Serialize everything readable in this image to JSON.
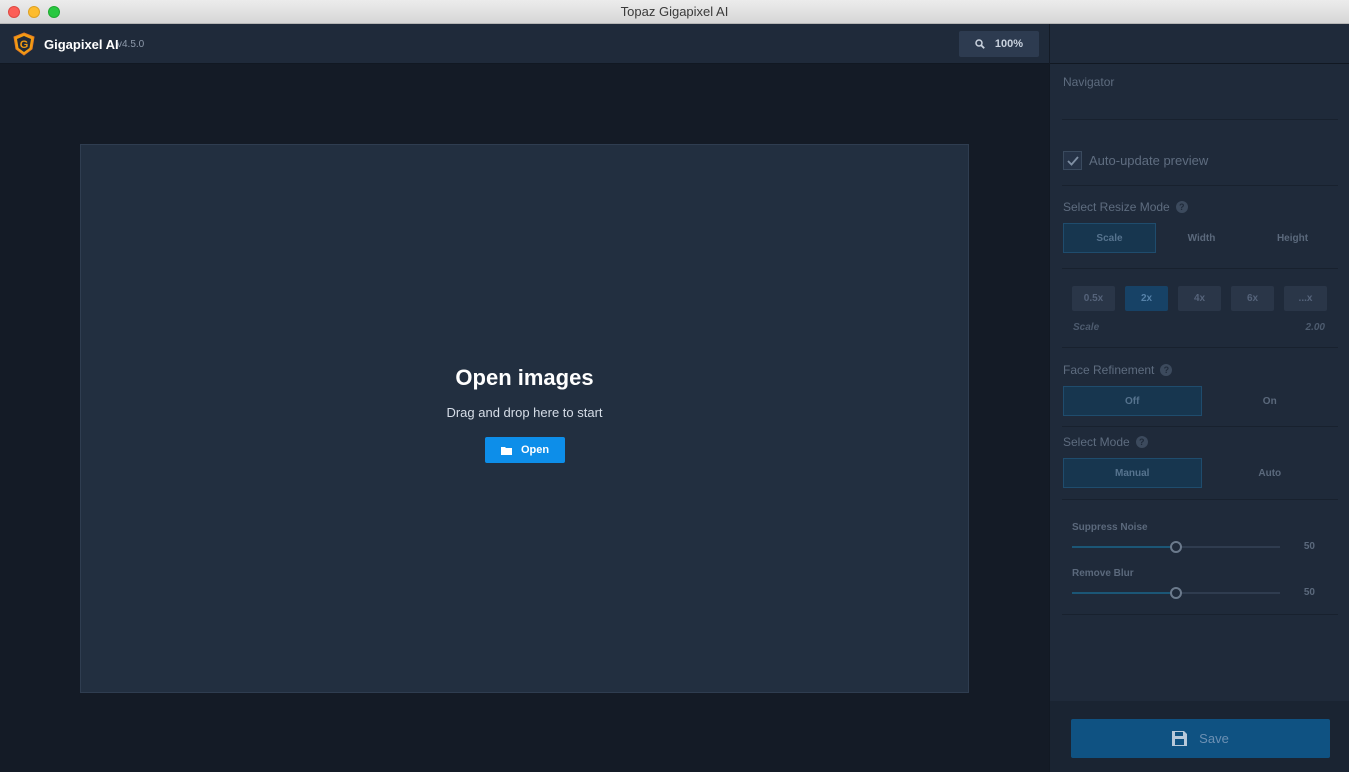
{
  "window": {
    "title": "Topaz Gigapixel AI"
  },
  "app": {
    "name": "Gigapixel AI",
    "version": "v4.5.0",
    "zoom": "100%"
  },
  "dropzone": {
    "title": "Open images",
    "subtitle": "Drag and drop here to start",
    "open_label": "Open"
  },
  "panel": {
    "navigator_label": "Navigator",
    "auto_update": {
      "label": "Auto-update preview",
      "checked": true
    },
    "resize_mode": {
      "label": "Select Resize Mode",
      "help": "?",
      "options": [
        "Scale",
        "Width",
        "Height"
      ],
      "selected": "Scale"
    },
    "scale": {
      "options": [
        "0.5x",
        "2x",
        "4x",
        "6x",
        "...x"
      ],
      "selected": "2x",
      "label": "Scale",
      "value": "2.00"
    },
    "face_refinement": {
      "label": "Face Refinement",
      "help": "?",
      "options": [
        "Off",
        "On"
      ],
      "selected": "Off"
    },
    "mode": {
      "label": "Select Mode",
      "help": "?",
      "options": [
        "Manual",
        "Auto"
      ],
      "selected": "Manual"
    },
    "sliders": [
      {
        "label": "Suppress Noise",
        "value": "50",
        "fraction": 0.5
      },
      {
        "label": "Remove Blur",
        "value": "50",
        "fraction": 0.5
      }
    ],
    "save_label": "Save"
  },
  "colors": {
    "accent": "#0d8ee9",
    "panel_bg": "#1f2a3a",
    "canvas_bg": "#141b26"
  }
}
